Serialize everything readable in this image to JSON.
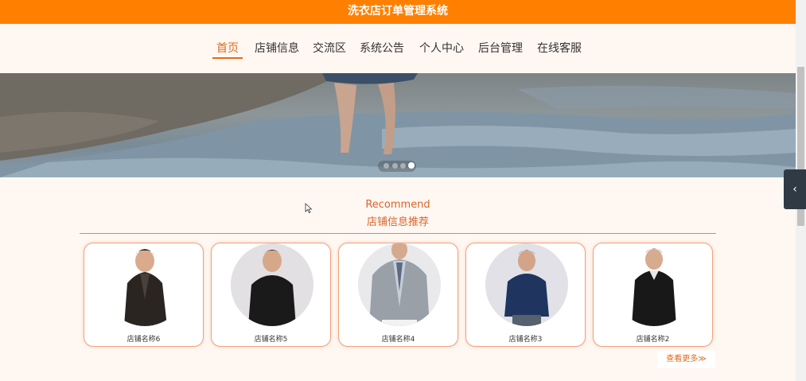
{
  "header": {
    "title": "洗衣店订单管理系统"
  },
  "nav": {
    "items": [
      {
        "label": "首页",
        "active": true
      },
      {
        "label": "店铺信息",
        "active": false
      },
      {
        "label": "交流区",
        "active": false
      },
      {
        "label": "系统公告",
        "active": false
      },
      {
        "label": "个人中心",
        "active": false
      },
      {
        "label": "后台管理",
        "active": false
      },
      {
        "label": "在线客服",
        "active": false
      }
    ]
  },
  "banner": {
    "slide_count": 4,
    "active_slide": 4
  },
  "recommend": {
    "title_en": "Recommend",
    "title_cn": "店铺信息推荐",
    "cards": [
      {
        "name": "店铺名称6"
      },
      {
        "name": "店铺名称5"
      },
      {
        "name": "店铺名称4"
      },
      {
        "name": "店铺名称3"
      },
      {
        "name": "店铺名称2"
      }
    ],
    "more_label": "查看更多≫"
  },
  "side_tab": {
    "icon": "chevron-left-icon",
    "glyph": "‹"
  },
  "colors": {
    "accent": "#ff7f00",
    "nav_active": "#e06b1a",
    "card_border": "#f0a27a"
  }
}
